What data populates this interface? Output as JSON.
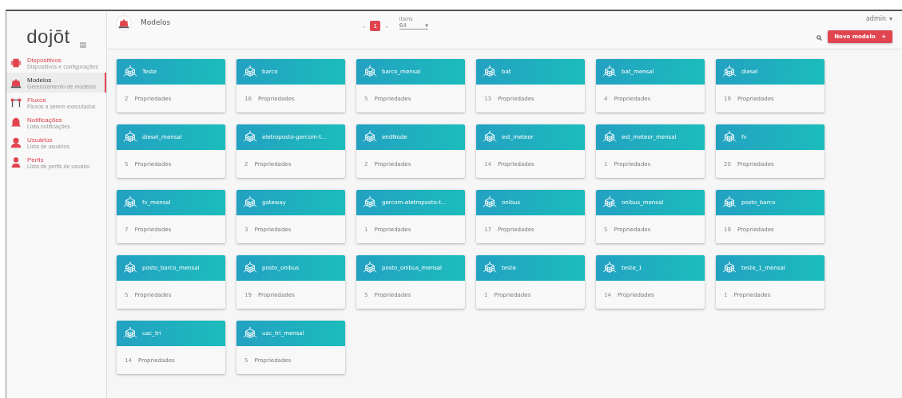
{
  "sidebar": {
    "logo": "dojōt",
    "items": [
      {
        "label": "Dispositivos",
        "subtitle": "Dispositivos e configurações",
        "selected": false
      },
      {
        "label": "Modelos",
        "subtitle": "Gerenciamento de modelos",
        "selected": true
      },
      {
        "label": "Fluxos",
        "subtitle": "Fluxos a serem executados",
        "selected": false
      },
      {
        "label": "Notificações",
        "subtitle": "Lista notificações",
        "selected": false
      },
      {
        "label": "Usuários",
        "subtitle": "Lista de usuários",
        "selected": false
      },
      {
        "label": "Perfis",
        "subtitle": "Lista de perfis de usuário",
        "selected": false
      }
    ]
  },
  "header": {
    "title": "Modelos",
    "user": "admin",
    "user_caret": "▾",
    "pagination": {
      "prev": "«",
      "page": "1",
      "next": "»",
      "items_label": "itens",
      "items_value": "64",
      "caret": "▾"
    },
    "new_button": "Novo modelo",
    "new_button_icon": "+"
  },
  "cards": [
    {
      "name": "Teste",
      "count": "2",
      "label": "Propriedades"
    },
    {
      "name": "barco",
      "count": "18",
      "label": "Propriedades"
    },
    {
      "name": "barco_mensal",
      "count": "5",
      "label": "Propriedades"
    },
    {
      "name": "bat",
      "count": "13",
      "label": "Propriedades"
    },
    {
      "name": "bat_mensal",
      "count": "4",
      "label": "Propriedades"
    },
    {
      "name": "diesel",
      "count": "19",
      "label": "Propriedades"
    },
    {
      "name": "diesel_mensal",
      "count": "5",
      "label": "Propriedades"
    },
    {
      "name": "eletroposto-gercom-t...",
      "count": "2",
      "label": "Propriedades"
    },
    {
      "name": "endNode",
      "count": "2",
      "label": "Propriedades"
    },
    {
      "name": "est_meteor",
      "count": "14",
      "label": "Propriedades"
    },
    {
      "name": "est_meteor_mensal",
      "count": "1",
      "label": "Propriedades"
    },
    {
      "name": "fv",
      "count": "20",
      "label": "Propriedades"
    },
    {
      "name": "fv_mensal",
      "count": "7",
      "label": "Propriedades"
    },
    {
      "name": "gateway",
      "count": "3",
      "label": "Propriedades"
    },
    {
      "name": "gercom-eletroposto-t...",
      "count": "1",
      "label": "Propriedades"
    },
    {
      "name": "onibus",
      "count": "17",
      "label": "Propriedades"
    },
    {
      "name": "onibus_mensal",
      "count": "5",
      "label": "Propriedades"
    },
    {
      "name": "posto_barco",
      "count": "19",
      "label": "Propriedades"
    },
    {
      "name": "posto_barco_mensal",
      "count": "5",
      "label": "Propriedades"
    },
    {
      "name": "posto_onibus",
      "count": "19",
      "label": "Propriedades"
    },
    {
      "name": "posto_onibus_mensal",
      "count": "5",
      "label": "Propriedades"
    },
    {
      "name": "teste",
      "count": "1",
      "label": "Propriedades"
    },
    {
      "name": "teste_1",
      "count": "14",
      "label": "Propriedades"
    },
    {
      "name": "teste_1_mensal",
      "count": "1",
      "label": "Propriedades"
    },
    {
      "name": "uac_tri",
      "count": "14",
      "label": "Propriedades"
    },
    {
      "name": "uac_tri_mensal",
      "count": "5",
      "label": "Propriedades"
    }
  ]
}
